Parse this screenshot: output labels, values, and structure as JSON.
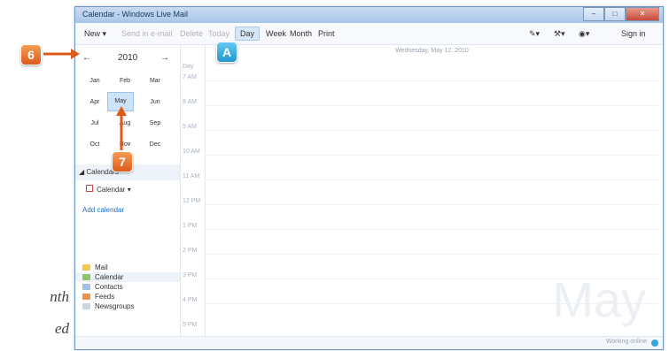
{
  "caption": {
    "line1": "nth",
    "line2": "ed"
  },
  "window": {
    "title": "Calendar - Windows Live Mail"
  },
  "toolbar": {
    "new": "New ▾",
    "send_email": "Send in e-mail",
    "delete": "Delete",
    "today": "Today",
    "day": "Day",
    "week": "Week",
    "month": "Month",
    "print": "Print",
    "sign_in": "Sign in"
  },
  "mini_calendar": {
    "prev": "←",
    "year": "2010",
    "next": "→",
    "months": [
      "Jan",
      "Feb",
      "Mar",
      "Apr",
      "May",
      "Jun",
      "Jul",
      "Aug",
      "Sep",
      "Oct",
      "Nov",
      "Dec"
    ],
    "selected_month": "May"
  },
  "calendars": {
    "section_label": "◢ Calendars",
    "item": "Calendar ▾",
    "add": "Add calendar"
  },
  "nav": [
    "Mail",
    "Calendar",
    "Contacts",
    "Feeds",
    "Newsgroups"
  ],
  "times": [
    "Day",
    "7 AM",
    "8 AM",
    "9 AM",
    "10 AM",
    "11 AM",
    "12 PM",
    "1 PM",
    "2 PM",
    "3 PM",
    "4 PM",
    "5 PM"
  ],
  "main": {
    "date_header": "Wednesday, May 12, 2010",
    "watermark": "May"
  },
  "status": {
    "text": "Working online"
  },
  "callouts": {
    "six": "6",
    "seven": "7",
    "a": "A"
  },
  "colors": {
    "accent": "#de5a19",
    "callout_blue": "#2198cf",
    "selection": "#cde3f7"
  }
}
